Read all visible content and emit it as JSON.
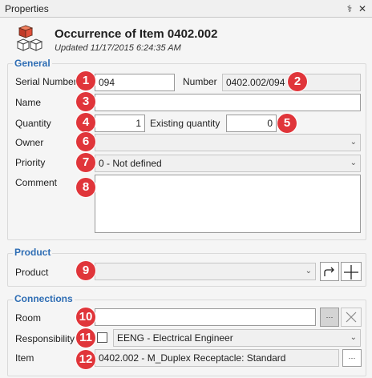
{
  "window": {
    "title": "Properties",
    "pin_glyph": "⚕",
    "close_glyph": "✕"
  },
  "header": {
    "title": "Occurrence of Item 0402.002",
    "subtitle": "Updated 11/17/2015 6:24:35 AM",
    "icon": "cube-stack-icon"
  },
  "general": {
    "title": "General",
    "serial_label": "Serial Number",
    "serial_value": "094",
    "number_label": "Number",
    "number_value": "0402.002/094",
    "name_label": "Name",
    "name_value": "",
    "quantity_label": "Quantity",
    "quantity_value": "1",
    "existing_label": "Existing quantity",
    "existing_value": "0",
    "owner_label": "Owner",
    "owner_value": "",
    "priority_label": "Priority",
    "priority_value": "0 - Not defined",
    "comment_label": "Comment",
    "comment_value": ""
  },
  "product": {
    "title": "Product",
    "product_label": "Product",
    "product_value": ""
  },
  "connections": {
    "title": "Connections",
    "room_label": "Room",
    "room_value": "",
    "ellipsis": "···",
    "responsibility_label": "Responsibility",
    "responsibility_value": "EENG - Electrical Engineer",
    "item_label": "Item",
    "item_value": "0402.002 - M_Duplex Receptacle: Standard"
  },
  "badges": [
    "1",
    "2",
    "3",
    "4",
    "5",
    "6",
    "7",
    "8",
    "9",
    "10",
    "11",
    "12"
  ],
  "colors": {
    "accent": "#2e6db4",
    "badge": "#e0353a",
    "cube": "#e0503a"
  }
}
